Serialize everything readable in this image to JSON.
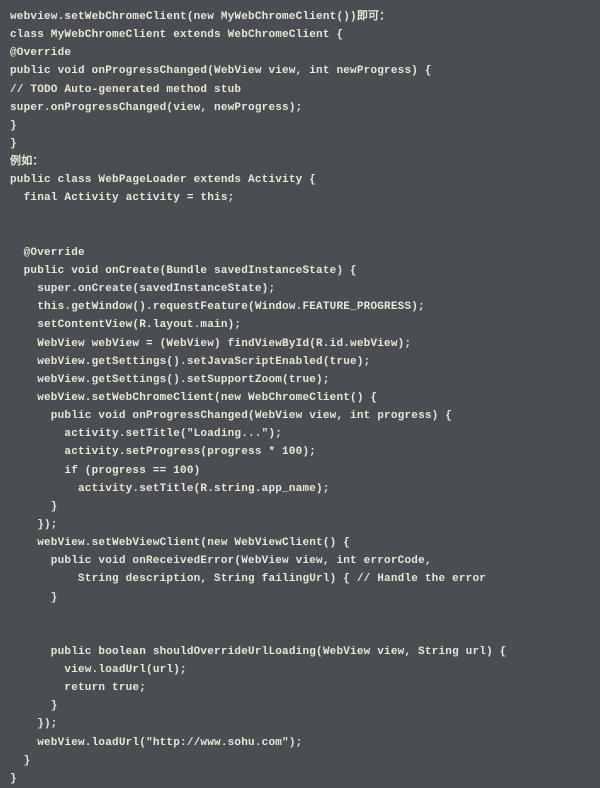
{
  "code_lines": [
    "webview.setWebChromeClient(new MyWebChromeClient())即可：",
    "class MyWebChromeClient extends WebChromeClient {",
    "@Override",
    "public void onProgressChanged(WebView view, int newProgress) {",
    "// TODO Auto-generated method stub",
    "super.onProgressChanged(view, newProgress);",
    "}",
    "}",
    "例如：",
    "public class WebPageLoader extends Activity {",
    "  final Activity activity = this;",
    "",
    "",
    "  @Override",
    "  public void onCreate(Bundle savedInstanceState) {",
    "    super.onCreate(savedInstanceState);",
    "    this.getWindow().requestFeature(Window.FEATURE_PROGRESS);",
    "    setContentView(R.layout.main);",
    "    WebView webView = (WebView) findViewById(R.id.webView);",
    "    webView.getSettings().setJavaScriptEnabled(true);",
    "    webView.getSettings().setSupportZoom(true);",
    "    webView.setWebChromeClient(new WebChromeClient() {",
    "      public void onProgressChanged(WebView view, int progress) {",
    "        activity.setTitle(\"Loading...\");",
    "        activity.setProgress(progress * 100);",
    "        if (progress == 100)",
    "          activity.setTitle(R.string.app_name);",
    "      }",
    "    });",
    "    webView.setWebViewClient(new WebViewClient() {",
    "      public void onReceivedError(WebView view, int errorCode,",
    "          String description, String failingUrl) { // Handle the error",
    "      }",
    "",
    "",
    "      public boolean shouldOverrideUrlLoading(WebView view, String url) {",
    "        view.loadUrl(url);",
    "        return true;",
    "      }",
    "    });",
    "    webView.loadUrl(\"http://www.sohu.com\");",
    "  }",
    "}"
  ]
}
